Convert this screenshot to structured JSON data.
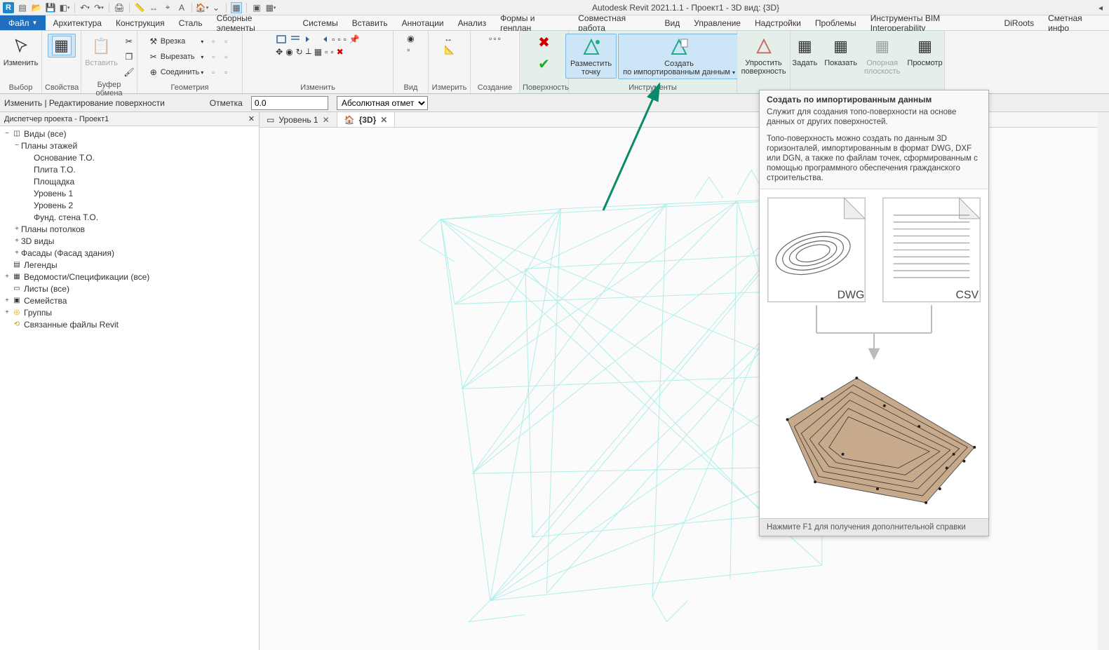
{
  "title": "Autodesk Revit 2021.1.1 - Проект1 - 3D вид: {3D}",
  "qat": [
    "R",
    "▤",
    "🗎",
    "💾",
    "◧",
    "↶",
    "↷",
    "🖨",
    "≡",
    "↔",
    "⌖",
    "A",
    "🏠",
    "⌄",
    "?",
    "▦",
    "▤",
    "▦"
  ],
  "menu": {
    "file": "Файл",
    "tabs": [
      "Архитектура",
      "Конструкция",
      "Сталь",
      "Сборные элементы",
      "Системы",
      "Вставить",
      "Аннотации",
      "Анализ",
      "Формы и генплан",
      "Совместная работа",
      "Вид",
      "Управление",
      "Надстройки",
      "Проблемы",
      "Инструменты BIM Interoperability",
      "DiRoots",
      "Сметная инфо"
    ]
  },
  "ribbon": {
    "panels": {
      "select": {
        "label": "Выбор",
        "btn": "Изменить"
      },
      "props": {
        "label": "Свойства"
      },
      "clipboard": {
        "label": "Буфер обмена",
        "paste": "Вставить"
      },
      "geom": {
        "label": "Геометрия",
        "r1": "Врезка",
        "r2": "Вырезать",
        "r3": "Соединить"
      },
      "modify": {
        "label": "Изменить"
      },
      "view": {
        "label": "Вид"
      },
      "measure": {
        "label": "Измерить"
      },
      "create": {
        "label": "Создание"
      },
      "surface": {
        "label": "Поверхность"
      },
      "place_point": {
        "l1": "Разместить",
        "l2": "точку"
      },
      "create_import": {
        "l1": "Создать",
        "l2": "по импортированным данным"
      },
      "tools": {
        "label": "Инструменты"
      },
      "simplify": {
        "l1": "Упростить",
        "l2": "поверхность"
      },
      "set": {
        "l1": "Задать"
      },
      "show": {
        "l1": "Показать"
      },
      "refplane": {
        "l1": "Опорная",
        "l2": "плоскость"
      },
      "viewer": {
        "l1": "Просмотр"
      }
    }
  },
  "options_bar": {
    "context": "Изменить | Редактирование поверхности",
    "elev_label": "Отметка",
    "elev_value": "0.0",
    "elev_mode": "Абсолютная отметка"
  },
  "browser": {
    "header": "Диспетчер проекта - Проект1",
    "tree": {
      "root": "Виды (все)",
      "floor_plans": "Планы этажей",
      "floor_items": [
        "Основание Т.О.",
        "Плита Т.О.",
        "Площадка",
        "Уровень 1",
        "Уровень 2",
        "Фунд. стена Т.О."
      ],
      "ceiling": "Планы потолков",
      "v3d": "3D виды",
      "elevs": "Фасады (Фасад здания)",
      "legends": "Легенды",
      "schedules": "Ведомости/Спецификации (все)",
      "sheets": "Листы (все)",
      "families": "Семейства",
      "groups": "Группы",
      "links": "Связанные файлы Revit"
    }
  },
  "view_tabs": {
    "t1": "Уровень 1",
    "t2": "{3D}"
  },
  "tooltip": {
    "title": "Создать по импортированным данным",
    "desc1": "Служит для создания топо-поверхности на основе данных от других поверхностей.",
    "desc2": "Топо-поверхность можно создать по данным 3D горизонталей, импортированным в формат DWG, DXF или DGN, а также по файлам точек, сформированным с помощью программного обеспечения гражданского строительства.",
    "dwg": "DWG",
    "csv": "CSV",
    "footer": "Нажмите F1 для получения дополнительной справки"
  }
}
